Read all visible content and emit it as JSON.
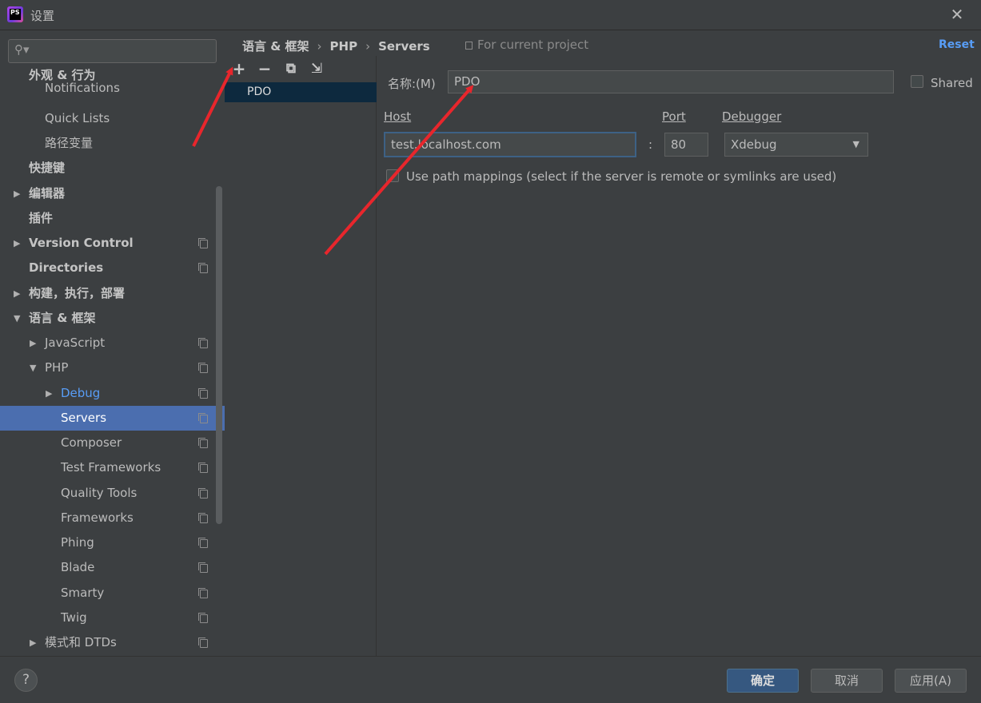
{
  "window": {
    "title": "设置",
    "close_label": "✕",
    "app_icon_text": "PS"
  },
  "search": {
    "placeholder": "",
    "icon": "search-icon"
  },
  "tree": [
    {
      "label": "外观 & 行为",
      "bold": true
    },
    {
      "label": "Notifications"
    },
    {
      "label": "Quick Lists"
    },
    {
      "label": "路径变量"
    },
    {
      "label": "快捷键",
      "bold": true
    },
    {
      "label": "编辑器",
      "bold": true,
      "arrow": "▶"
    },
    {
      "label": "插件",
      "bold": true
    },
    {
      "label": "Version Control",
      "bold": true,
      "arrow": "▶"
    },
    {
      "label": "Directories",
      "bold": true
    },
    {
      "label": "构建，执行，部署",
      "bold": true,
      "arrow": "▶"
    },
    {
      "label": "语言 & 框架",
      "bold": true,
      "arrow": "▼"
    },
    {
      "label": "JavaScript",
      "arrow": "▶"
    },
    {
      "label": "PHP",
      "arrow": "▼"
    },
    {
      "label": "Debug",
      "arrow": "▶"
    },
    {
      "label": "Servers"
    },
    {
      "label": "Composer"
    },
    {
      "label": "Test Frameworks"
    },
    {
      "label": "Quality Tools"
    },
    {
      "label": "Frameworks"
    },
    {
      "label": "Phing"
    },
    {
      "label": "Blade"
    },
    {
      "label": "Smarty"
    },
    {
      "label": "Twig"
    },
    {
      "label": "模式和 DTDs",
      "arrow": "▶"
    }
  ],
  "breadcrumb": {
    "level1": "语言 & 框架",
    "level2": "PHP",
    "level3": "Servers",
    "sep": "›"
  },
  "scope_label": "For current project",
  "reset_label": "Reset",
  "toolbar": {
    "add": "+",
    "remove": "−",
    "copy": "⧉",
    "import": "⇲"
  },
  "servers": [
    "PDO"
  ],
  "form": {
    "name_label": "名称:(M)",
    "name_value": "PDO",
    "shared_label": "Shared",
    "host_label": "Host",
    "host_value": "test.localhost.com",
    "port_label": "Port",
    "port_value": "80",
    "colon": ":",
    "debugger_label": "Debugger",
    "debugger_value": "Xdebug",
    "caret": "▼",
    "path_mappings_label": "Use path mappings (select if the server is remote or symlinks are used)"
  },
  "footer": {
    "help": "?",
    "ok": "确定",
    "cancel": "取消",
    "apply": "应用(A)"
  },
  "colors": {
    "accent": "#589df6",
    "selection": "#4b6eaf",
    "annotation": "#e8262c"
  }
}
